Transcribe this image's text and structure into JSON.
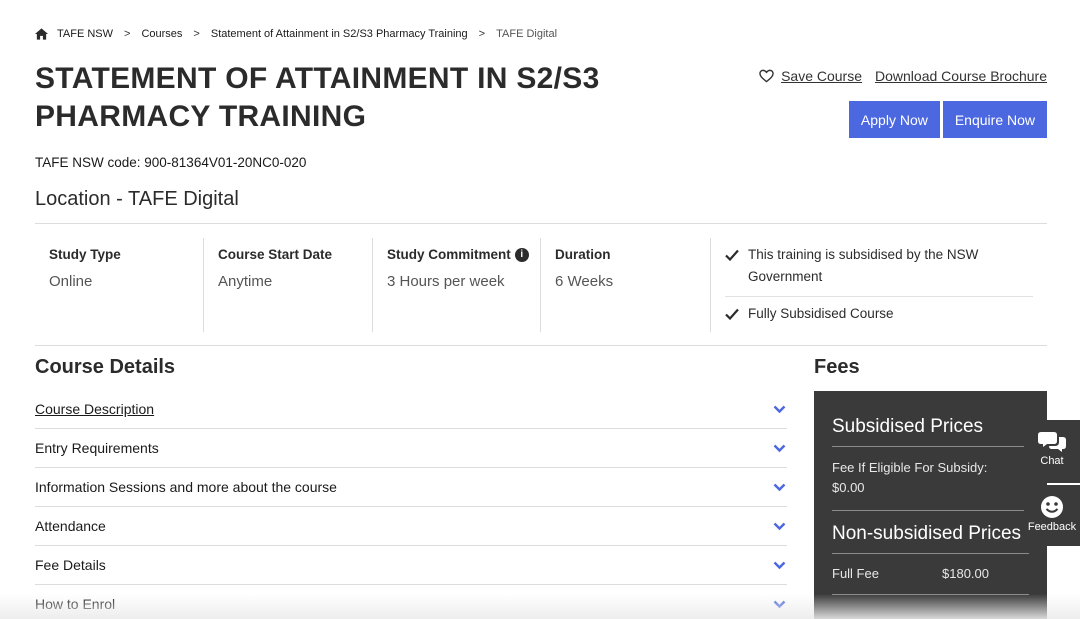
{
  "breadcrumb": {
    "items": [
      "TAFE NSW",
      "Courses",
      "Statement of Attainment in S2/S3 Pharmacy Training",
      "TAFE Digital"
    ],
    "separator": ">"
  },
  "course": {
    "title": "STATEMENT OF ATTAINMENT IN S2/S3 PHARMACY TRAINING",
    "code": "TAFE NSW code: 900-81364V01-20NC0-020",
    "location": "Location - TAFE Digital"
  },
  "actions": {
    "save_label": "Save Course",
    "brochure_label": "Download Course Brochure",
    "apply_label": "Apply Now",
    "enquire_label": "Enquire Now"
  },
  "info": {
    "study_type": {
      "label": "Study Type",
      "value": "Online"
    },
    "start_date": {
      "label": "Course Start Date",
      "value": "Anytime"
    },
    "commitment": {
      "label": "Study Commitment",
      "value": "3 Hours per week",
      "info_glyph": "i"
    },
    "duration": {
      "label": "Duration",
      "value": "6 Weeks"
    }
  },
  "checks": [
    "This training is subsidised by the NSW Government",
    "Fully Subsidised Course"
  ],
  "details": {
    "title": "Course Details",
    "sections": [
      "Course Description",
      "Entry Requirements",
      "Information Sessions and more about the course",
      "Attendance",
      "Fee Details",
      "How to Enrol"
    ]
  },
  "fees": {
    "title": "Fees",
    "subsidised_heading": "Subsidised Prices",
    "subsidy_label": "Fee If Eligible For Subsidy:",
    "subsidy_value": "$0.00",
    "non_subsidised_heading": "Non-subsidised Prices",
    "full_fee_label": "Full Fee",
    "full_fee_value": "$180.00"
  },
  "side_tabs": {
    "chat": "Chat",
    "feedback": "Feedback"
  },
  "colors": {
    "accent": "#4b68e0",
    "dark_panel": "#3a3a3a"
  }
}
